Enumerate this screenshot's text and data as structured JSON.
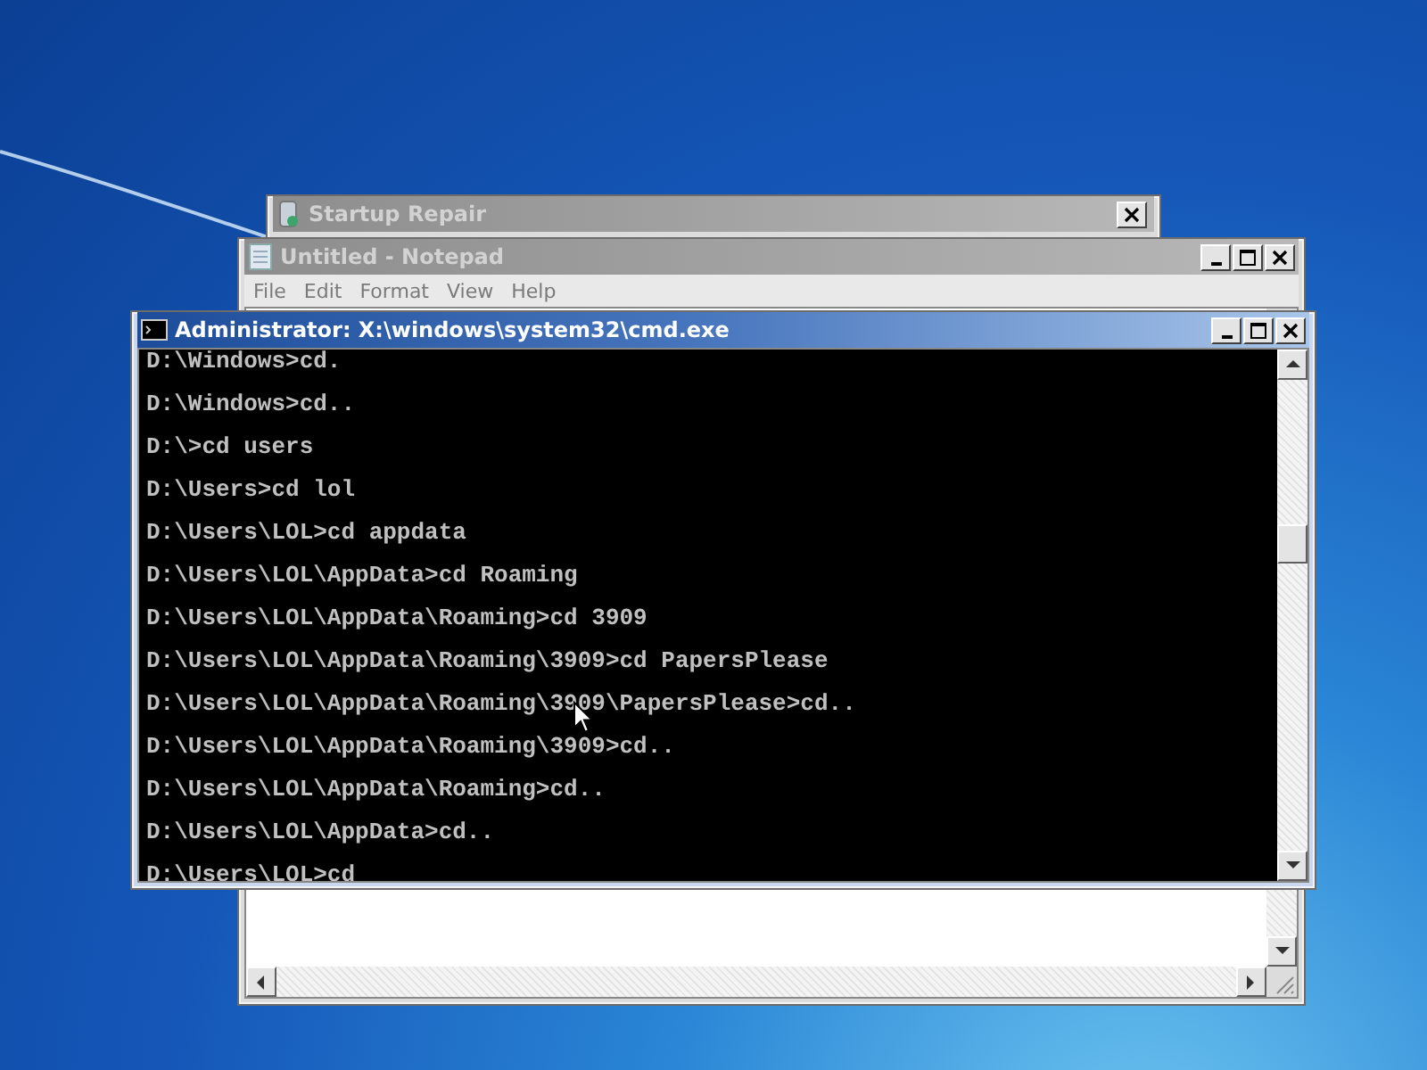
{
  "windows": [
    {
      "kind": "dialog",
      "title": "Startup Repair",
      "active": false
    },
    {
      "kind": "notepad",
      "title": "Untitled - Notepad",
      "active": false,
      "menu": [
        "File",
        "Edit",
        "Format",
        "View",
        "Help"
      ]
    },
    {
      "kind": "console",
      "title": "Administrator: X:\\windows\\system32\\cmd.exe",
      "active": true,
      "lines": [
        "D:\\Windows>cd.",
        "D:\\Windows>cd..",
        "D:\\>cd users",
        "D:\\Users>cd lol",
        "D:\\Users\\LOL>cd appdata",
        "D:\\Users\\LOL\\AppData>cd Roaming",
        "D:\\Users\\LOL\\AppData\\Roaming>cd 3909",
        "D:\\Users\\LOL\\AppData\\Roaming\\3909>cd PapersPlease",
        "D:\\Users\\LOL\\AppData\\Roaming\\3909\\PapersPlease>cd..",
        "D:\\Users\\LOL\\AppData\\Roaming\\3909>cd..",
        "D:\\Users\\LOL\\AppData\\Roaming>cd..",
        "D:\\Users\\LOL\\AppData>cd..",
        "D:\\Users\\LOL>cd"
      ]
    }
  ]
}
